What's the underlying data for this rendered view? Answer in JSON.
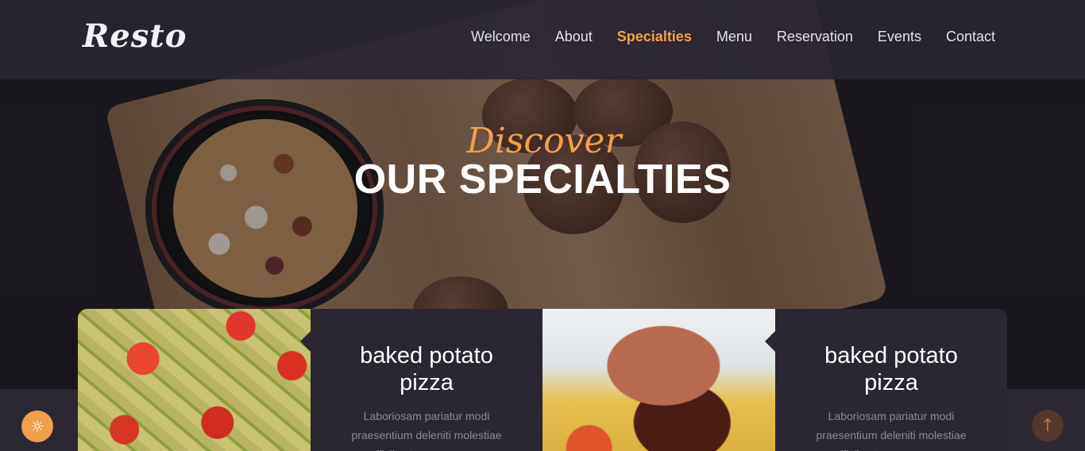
{
  "brand": {
    "logo": "Resto"
  },
  "nav": {
    "items": [
      {
        "label": "Welcome",
        "active": false
      },
      {
        "label": "About",
        "active": false
      },
      {
        "label": "Specialties",
        "active": true
      },
      {
        "label": "Menu",
        "active": false
      },
      {
        "label": "Reservation",
        "active": false
      },
      {
        "label": "Events",
        "active": false
      },
      {
        "label": "Contact",
        "active": false
      }
    ]
  },
  "hero": {
    "kicker": "Discover",
    "headline": "OUR SPECIALTIES"
  },
  "cards": [
    {
      "title": "baked potato pizza",
      "description": "Laboriosam pariatur modi praesentium deleniti molestiae officiis atque numquam",
      "image": "pasta-salad"
    },
    {
      "title": "baked potato pizza",
      "description": "Laboriosam pariatur modi praesentium deleniti molestiae officiis atque numquam",
      "image": "rice-and-meat"
    }
  ],
  "buttons": {
    "theme_icon": "☼",
    "back_to_top_icon": "↑"
  },
  "colors": {
    "accent": "#f0a04b",
    "nav_bg": "#282532",
    "card_bg": "#2a2733",
    "page_bg": "#2b2834"
  }
}
